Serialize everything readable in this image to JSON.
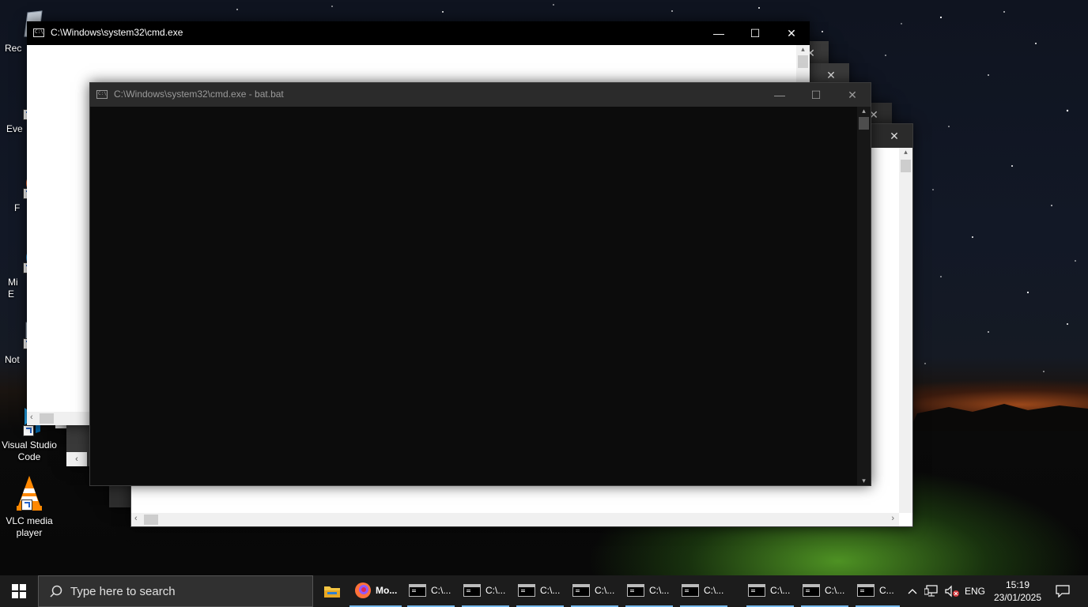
{
  "desktop": {
    "icons": [
      {
        "label": "Rec",
        "icon": "recycle-bin-icon"
      },
      {
        "label": "Eve",
        "icon": "app-shortcut-icon"
      },
      {
        "label": "F",
        "icon": "firefox-icon"
      },
      {
        "label": "Mi\nE",
        "icon": "edge-icon"
      },
      {
        "label": "Not",
        "icon": "notepad-icon"
      },
      {
        "label": "Visual Studio\nCode",
        "icon": "vscode-icon"
      },
      {
        "label": "VLC media\nplayer",
        "icon": "vlc-icon"
      }
    ]
  },
  "windows": {
    "back": {
      "title": "C:\\Windows\\system32\\cmd.exe",
      "minimize": "—",
      "maximize": "☐",
      "close": "✕"
    },
    "front": {
      "title": "C:\\Windows\\system32\\cmd.exe - bat.bat",
      "minimize": "—",
      "maximize": "☐",
      "close": "✕"
    },
    "stack_close": "✕"
  },
  "taskbar": {
    "search_placeholder": "Type here to search",
    "firefox_label": "Mo...",
    "cmd_items": [
      "C:\\...",
      "C:\\...",
      "C:\\...",
      "C:\\...",
      "C:\\...",
      "C:\\...",
      "C:\\...",
      "C:\\...",
      "C..."
    ],
    "language": "ENG",
    "time": "15:19",
    "date": "23/01/2025"
  },
  "colors": {
    "cmd_background": "#0c0c0c",
    "titlebar_inactive": "#2b2b2b",
    "titlebar_active": "#000000",
    "taskbar": "#1c1c1c",
    "accent": "#76b9ed"
  }
}
